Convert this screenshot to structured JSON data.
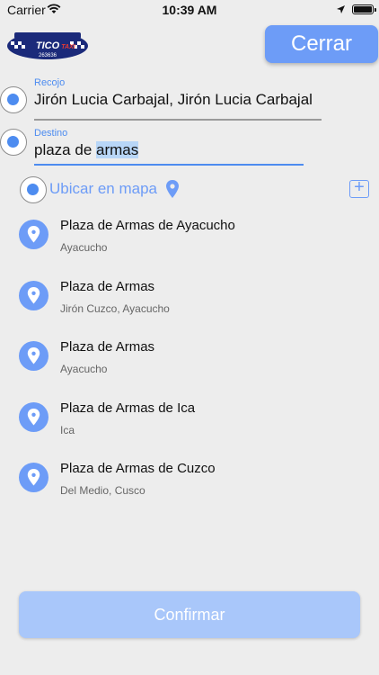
{
  "status_bar": {
    "carrier": "Carrier",
    "time": "10:39 AM"
  },
  "header": {
    "logo_text": "TICO TAXI",
    "logo_phone": "263636",
    "close_label": "Cerrar"
  },
  "pickup": {
    "label": "Recojo",
    "value": "Jirón Lucia Carbajal, Jirón Lucia Carbajal"
  },
  "destination": {
    "label": "Destino",
    "value_prefix": "plaza de ",
    "value_selected": "armas"
  },
  "map_option": {
    "label": "Ubicar en mapa",
    "add_label": "+"
  },
  "results": [
    {
      "title": "Plaza de Armas de Ayacucho",
      "subtitle": "Ayacucho"
    },
    {
      "title": "Plaza de Armas",
      "subtitle": "Jirón Cuzco, Ayacucho"
    },
    {
      "title": "Plaza de Armas",
      "subtitle": "Ayacucho"
    },
    {
      "title": "Plaza de Armas de Ica",
      "subtitle": "Ica"
    },
    {
      "title": "Plaza de Armas de Cuzco",
      "subtitle": "Del Medio, Cusco"
    }
  ],
  "confirm_label": "Confirmar",
  "colors": {
    "accent": "#6d9cf7",
    "accent_disabled": "#a9c7fa",
    "background": "#ededed"
  }
}
